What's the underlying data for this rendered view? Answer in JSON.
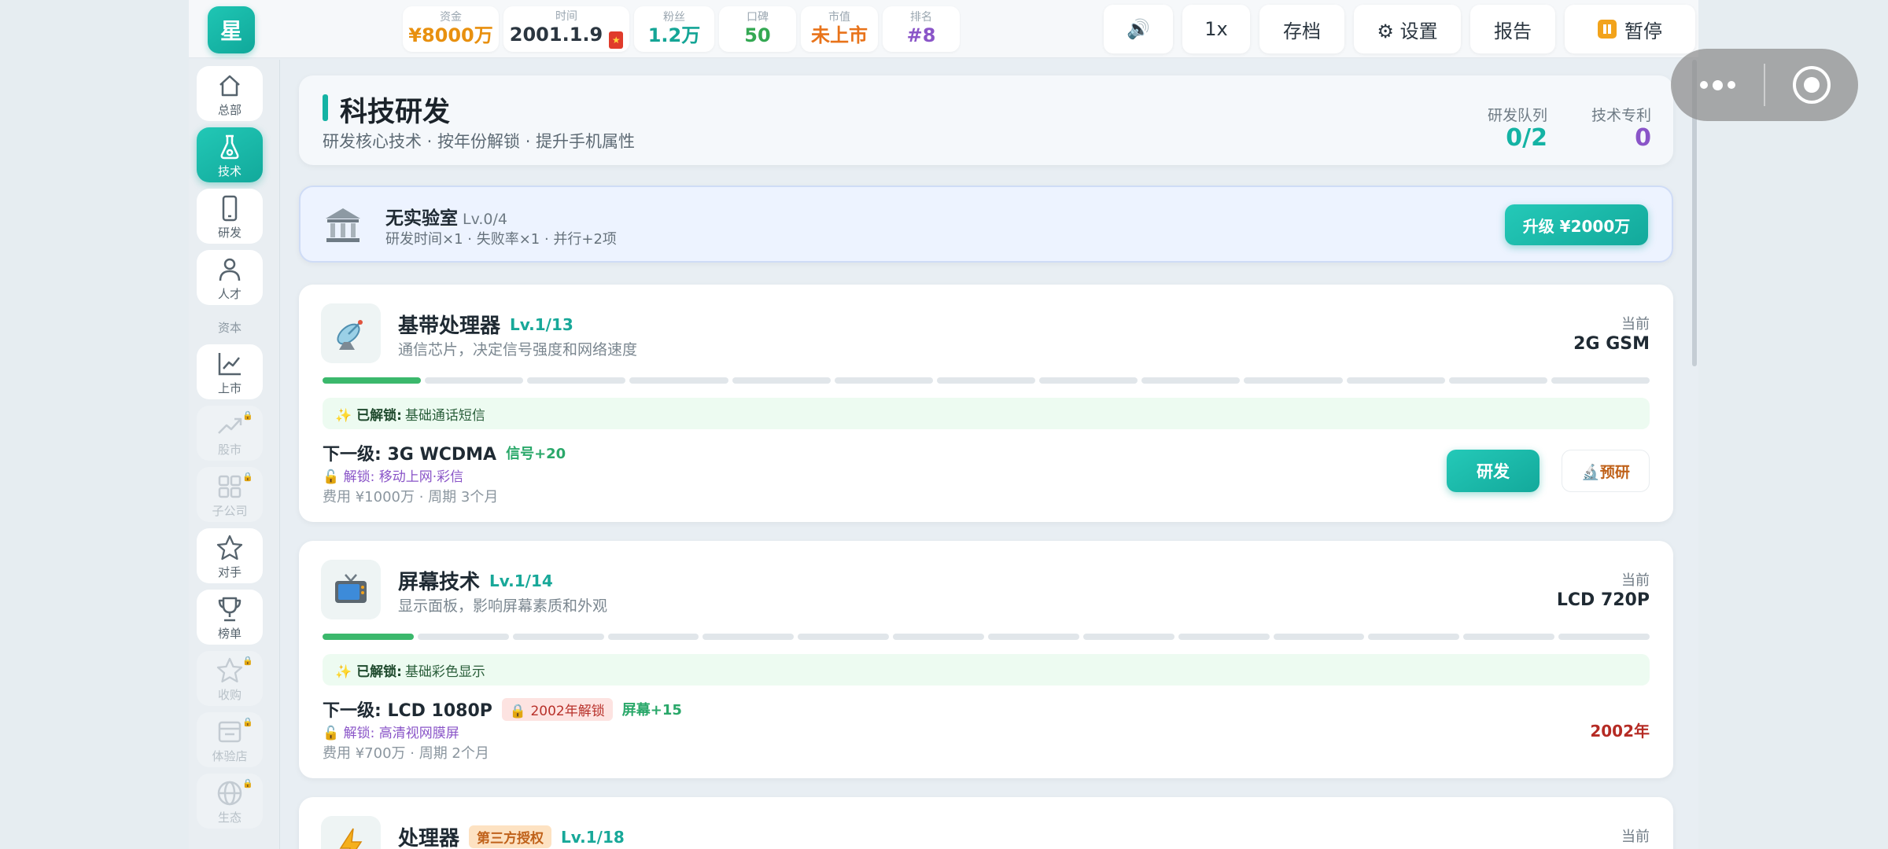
{
  "topbar": {
    "logo": "星",
    "stats": [
      {
        "label": "资金",
        "value": "¥8000万",
        "color": "#e8900f"
      },
      {
        "label": "时间",
        "value": "2001.1.9",
        "color": "#2b3640"
      },
      {
        "label": "粉丝",
        "value": "1.2万",
        "color": "#14a596"
      },
      {
        "label": "口碑",
        "value": "50",
        "color": "#34a853"
      },
      {
        "label": "市值",
        "value": "未上市",
        "color": "#e8731a"
      },
      {
        "label": "排名",
        "value": "#8",
        "color": "#8a55c8"
      }
    ],
    "buttons": {
      "sound": "🔊",
      "speed": "1x",
      "save": "存档",
      "settings": "⚙ 设置",
      "report": "报告",
      "pause": "暂停"
    }
  },
  "sidebar": {
    "items": [
      {
        "label": "总部",
        "icon": "home-icon",
        "state": "normal"
      },
      {
        "label": "技术",
        "icon": "flask-icon",
        "state": "active"
      },
      {
        "label": "研发",
        "icon": "phone-icon",
        "state": "normal"
      },
      {
        "label": "人才",
        "icon": "person-icon",
        "state": "normal"
      },
      {
        "label": "上市",
        "icon": "chart-icon",
        "state": "normal"
      },
      {
        "label": "股市",
        "icon": "trend-icon",
        "state": "locked"
      },
      {
        "label": "子公司",
        "icon": "grid-icon",
        "state": "locked"
      },
      {
        "label": "对手",
        "icon": "star-icon",
        "state": "normal"
      },
      {
        "label": "榜单",
        "icon": "trophy-icon",
        "state": "normal"
      },
      {
        "label": "收购",
        "icon": "star-icon",
        "state": "locked"
      },
      {
        "label": "体验店",
        "icon": "store-icon",
        "state": "locked"
      },
      {
        "label": "生态",
        "icon": "globe-icon",
        "state": "locked"
      }
    ],
    "section_capital": "资本"
  },
  "header": {
    "title": "科技研发",
    "subtitle": "研发核心技术 · 按年份解锁 · 提升手机属性",
    "queue_label": "研发队列",
    "queue_value": "0/2",
    "patent_label": "技术专利",
    "patent_value": "0"
  },
  "lab": {
    "title": "无实验室",
    "level": "Lv.0/4",
    "desc": "研发时间×1 · 失败率×1 · 并行+2项",
    "upgrade": "升级 ¥2000万"
  },
  "techs": [
    {
      "name": "基带处理器",
      "level": "Lv.1/13",
      "icon": "satellite-icon",
      "desc": "通信芯片，决定信号强度和网络速度",
      "current_label": "当前",
      "current": "2G GSM",
      "progress_done": 1,
      "progress_total": 13,
      "unlocked_label": "✨ 已解锁:",
      "unlocked": "基础通话短信",
      "next": "下一级: 3G WCDMA",
      "bonus": "信号+20",
      "unlock_feat": "🔓 解锁: 移动上网·彩信",
      "cost": "费用 ¥1000万 · 周期 3个月",
      "rd_button": "研发",
      "pre_button": "🔬预研"
    },
    {
      "name": "屏幕技术",
      "level": "Lv.1/14",
      "icon": "tv-icon",
      "desc": "显示面板，影响屏幕素质和外观",
      "current_label": "当前",
      "current": "LCD 720P",
      "progress_done": 1,
      "progress_total": 14,
      "unlocked_label": "✨ 已解锁:",
      "unlocked": "基础彩色显示",
      "next": "下一级: LCD 1080P",
      "year_tag": "🔒 2002年解锁",
      "bonus": "屏幕+15",
      "unlock_feat": "🔓 解锁: 高清视网膜屏",
      "cost": "费用 ¥700万 · 周期 2个月",
      "year_lock": "2002年"
    },
    {
      "name": "处理器",
      "tag": "第三方授权",
      "level": "Lv.1/18",
      "icon": "lightning-icon",
      "current_label": "当前"
    }
  ]
}
